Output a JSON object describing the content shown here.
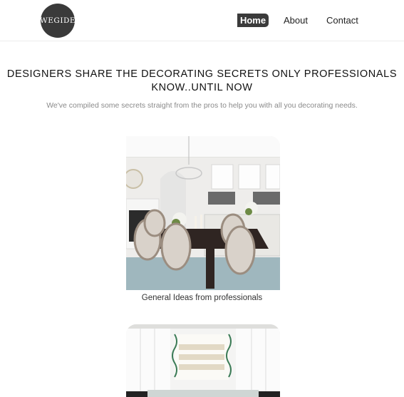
{
  "header": {
    "logo_text": "WEGIDE",
    "nav": {
      "home": "Home",
      "about": "About",
      "contact": "Contact"
    }
  },
  "hero": {
    "title_line1": "DESIGNERS SHARE THE DECORATING SECRETS ONLY PROFESSIONALS",
    "title_line2": "KNOW..UNTIL NOW",
    "subtitle": "We've compiled some secrets straight from the pros to help you with all you decorating needs."
  },
  "cards": [
    {
      "caption": "General Ideas from professionals"
    }
  ]
}
